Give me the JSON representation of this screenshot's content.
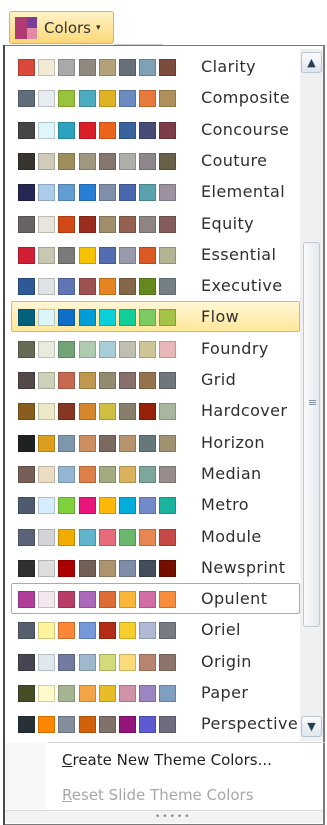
{
  "header": {
    "button_label": "Colors",
    "dropdown_glyph": "▾"
  },
  "themes": [
    {
      "name": "Clarity",
      "colors": [
        "#d9483b",
        "#f2ead6",
        "#a9a9a9",
        "#8f8a80",
        "#b3a17a",
        "#666f7a",
        "#7ea1b7",
        "#7c4c3e"
      ]
    },
    {
      "name": "Composite",
      "colors": [
        "#5f6e7a",
        "#e7ecef",
        "#98c33b",
        "#4dabc0",
        "#e0b324",
        "#6b8cc0",
        "#e77a3a",
        "#b0905a"
      ]
    },
    {
      "name": "Concourse",
      "colors": [
        "#464646",
        "#def5fa",
        "#2da2bf",
        "#da1f28",
        "#eb641b",
        "#39639d",
        "#474b78",
        "#7d3c4a"
      ]
    },
    {
      "name": "Couture",
      "colors": [
        "#37352e",
        "#d0ccb9",
        "#9e8e5c",
        "#a09781",
        "#85776d",
        "#aeafa9",
        "#8d878b",
        "#6b6149"
      ]
    },
    {
      "name": "Elemental",
      "colors": [
        "#242852",
        "#acccea",
        "#629dd1",
        "#297fd5",
        "#7f8fa9",
        "#4a66ac",
        "#5aa2ae",
        "#9d90a0"
      ]
    },
    {
      "name": "Equity",
      "colors": [
        "#696464",
        "#e9e5dc",
        "#d34817",
        "#9b2d1f",
        "#a28e6a",
        "#956251",
        "#918485",
        "#855d5d"
      ]
    },
    {
      "name": "Essential",
      "colors": [
        "#d11f34",
        "#c8c8b1",
        "#7a7a7a",
        "#f5c201",
        "#526db0",
        "#989aac",
        "#dc5924",
        "#b4b392"
      ]
    },
    {
      "name": "Executive",
      "colors": [
        "#2f5897",
        "#dfe3e5",
        "#6076b4",
        "#9c5252",
        "#e68422",
        "#846648",
        "#63891f",
        "#758085"
      ]
    },
    {
      "name": "Flow",
      "colors": [
        "#04617b",
        "#dbf5f9",
        "#0f6fc6",
        "#009dd9",
        "#0bd0d9",
        "#10cf9b",
        "#7cca62",
        "#a5c249"
      ]
    },
    {
      "name": "Foundry",
      "colors": [
        "#676a55",
        "#eaebde",
        "#72a376",
        "#b0ccb0",
        "#a8cdd7",
        "#c0beaf",
        "#cec597",
        "#e8b7b7"
      ]
    },
    {
      "name": "Grid",
      "colors": [
        "#534949",
        "#ccd1b9",
        "#c66951",
        "#bf974d",
        "#928b70",
        "#87706b",
        "#94734e",
        "#6f777d"
      ]
    },
    {
      "name": "Hardcover",
      "colors": [
        "#895d1d",
        "#ece9c6",
        "#873624",
        "#d6862d",
        "#d0be40",
        "#877f6c",
        "#972109",
        "#aab5a1"
      ]
    },
    {
      "name": "Horizon",
      "colors": [
        "#1f2123",
        "#dc9e1f",
        "#7e97ad",
        "#cc8e60",
        "#7a6a60",
        "#b4936d",
        "#67787b",
        "#9d936f"
      ]
    },
    {
      "name": "Median",
      "colors": [
        "#775f55",
        "#ebddc3",
        "#94b6d2",
        "#dd8047",
        "#a5ab81",
        "#d8b25c",
        "#7ba79d",
        "#968c8c"
      ]
    },
    {
      "name": "Metro",
      "colors": [
        "#4e5b6f",
        "#d6ecff",
        "#7fd13b",
        "#ea157a",
        "#feb80a",
        "#00addc",
        "#738ac8",
        "#1ab39f"
      ]
    },
    {
      "name": "Module",
      "colors": [
        "#5a6378",
        "#d4d4d6",
        "#f0ad00",
        "#60b5cc",
        "#e66c7d",
        "#6bb76d",
        "#e88651",
        "#c64847"
      ]
    },
    {
      "name": "Newsprint",
      "colors": [
        "#303030",
        "#dedede",
        "#ad0101",
        "#726056",
        "#ac956e",
        "#808da9",
        "#424e5b",
        "#730e00"
      ]
    },
    {
      "name": "Opulent",
      "colors": [
        "#b13f9a",
        "#f4e7ed",
        "#b83d68",
        "#ac66bb",
        "#de6c36",
        "#f9b639",
        "#cf6da4",
        "#fa8d3d"
      ]
    },
    {
      "name": "Oriel",
      "colors": [
        "#575f6d",
        "#fff39d",
        "#fe8637",
        "#7598d9",
        "#b32c16",
        "#f5cd2d",
        "#aebad5",
        "#777c84"
      ]
    },
    {
      "name": "Origin",
      "colors": [
        "#464653",
        "#dde9ec",
        "#727ca3",
        "#9fb8cd",
        "#d2da7a",
        "#fada7a",
        "#b88472",
        "#8e736a"
      ]
    },
    {
      "name": "Paper",
      "colors": [
        "#444d26",
        "#fefac9",
        "#a5b592",
        "#f3a447",
        "#e7bc29",
        "#d092a7",
        "#9c85c0",
        "#809ec2"
      ]
    },
    {
      "name": "Perspective",
      "colors": [
        "#283138",
        "#ff8600",
        "#838d9b",
        "#d2610c",
        "#80716a",
        "#94147c",
        "#5d5ad2",
        "#6f6c7d"
      ]
    }
  ],
  "selected_theme": "Flow",
  "menu": {
    "create_accel": "C",
    "create_rest": "reate New Theme Colors...",
    "reset_accel": "R",
    "reset_rest": "eset Slide Theme Colors"
  },
  "scrollbar": {
    "up_glyph": "▲",
    "down_glyph": "▼"
  },
  "footer": {
    "grip_glyph": "•••••"
  }
}
